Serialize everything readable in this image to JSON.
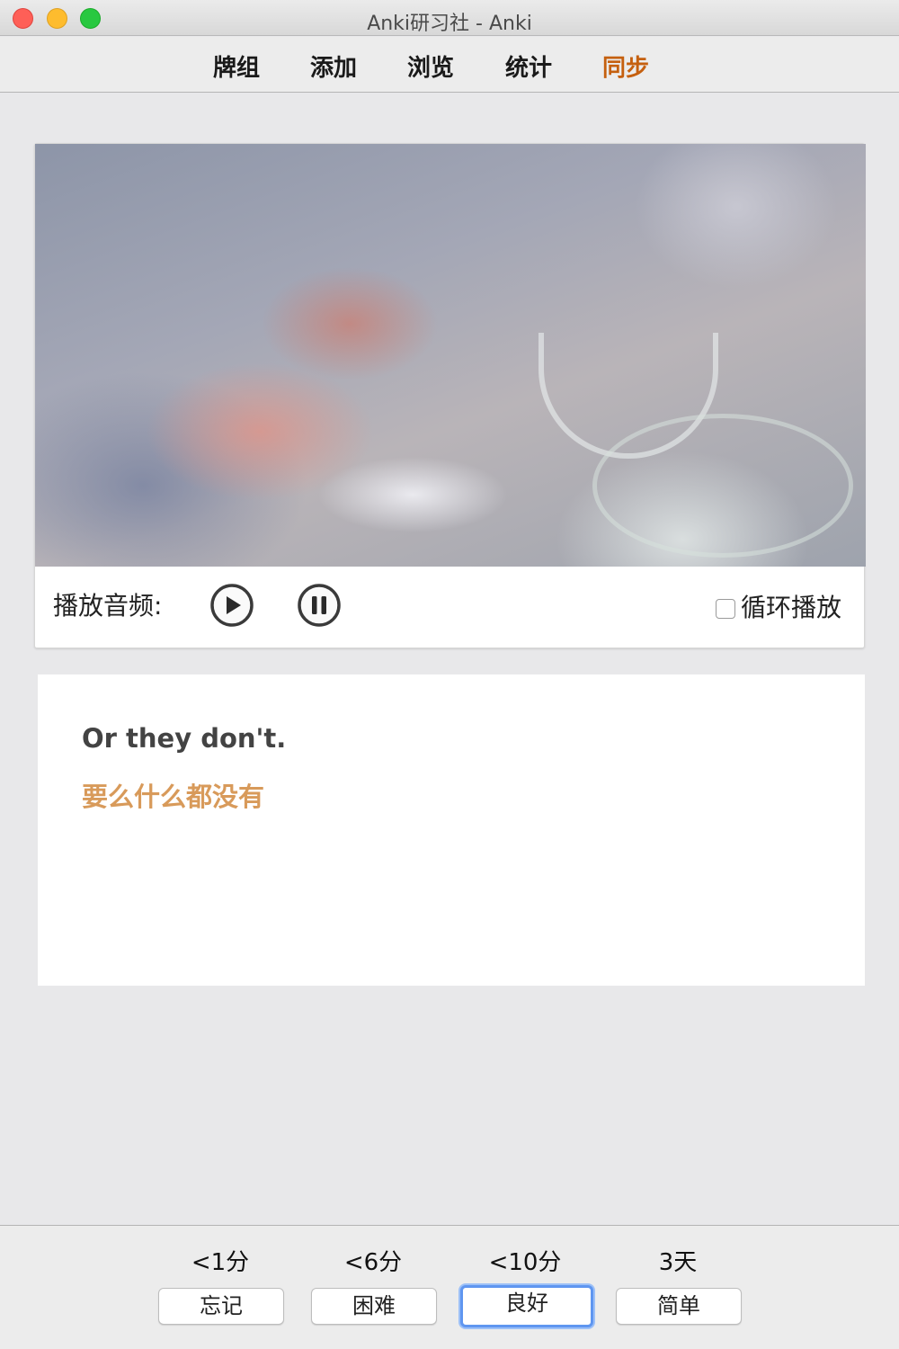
{
  "window": {
    "title": "Anki研习社 - Anki"
  },
  "toolbar": {
    "decks": "牌组",
    "add": "添加",
    "browse": "浏览",
    "stats": "统计",
    "sync": "同步",
    "sync_color": "#c5600f"
  },
  "player": {
    "audio_label": "播放音频:",
    "play_icon": "play-circle-icon",
    "pause_icon": "pause-circle-icon",
    "loop_label": "循环播放",
    "loop_checked": false
  },
  "card": {
    "english": "Or they don't.",
    "chinese": "要么什么都没有",
    "chinese_color": "#d89a5a"
  },
  "answers": [
    {
      "interval": "<1分",
      "label": "忘记"
    },
    {
      "interval": "<6分",
      "label": "困难"
    },
    {
      "interval": "<10分",
      "label": "良好",
      "focused": true
    },
    {
      "interval": "3天",
      "label": "简单"
    }
  ]
}
